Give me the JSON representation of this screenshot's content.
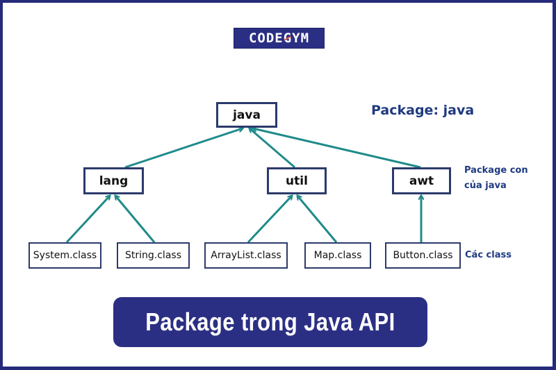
{
  "logo": {
    "text_before": "CODE",
    "text_accent": "G",
    "text_after": "YM"
  },
  "diagram": {
    "root": {
      "label": "java"
    },
    "packages": [
      {
        "label": "lang",
        "classes": [
          "System.class",
          "String.class"
        ]
      },
      {
        "label": "util",
        "classes": [
          "ArrayList.class",
          "Map.class"
        ]
      },
      {
        "label": "awt",
        "classes": [
          "Button.class"
        ]
      }
    ],
    "annotations": {
      "root_label": "Package: java",
      "subpackage_line1": "Package con",
      "subpackage_line2": "của java",
      "classes_label": "Các class"
    }
  },
  "title": "Package trong Java API",
  "colors": {
    "brand_navy": "#2b2f84",
    "arrow_teal": "#1f8a8a",
    "box_border": "#2b3a6b",
    "annotation_blue": "#1f3a80"
  }
}
